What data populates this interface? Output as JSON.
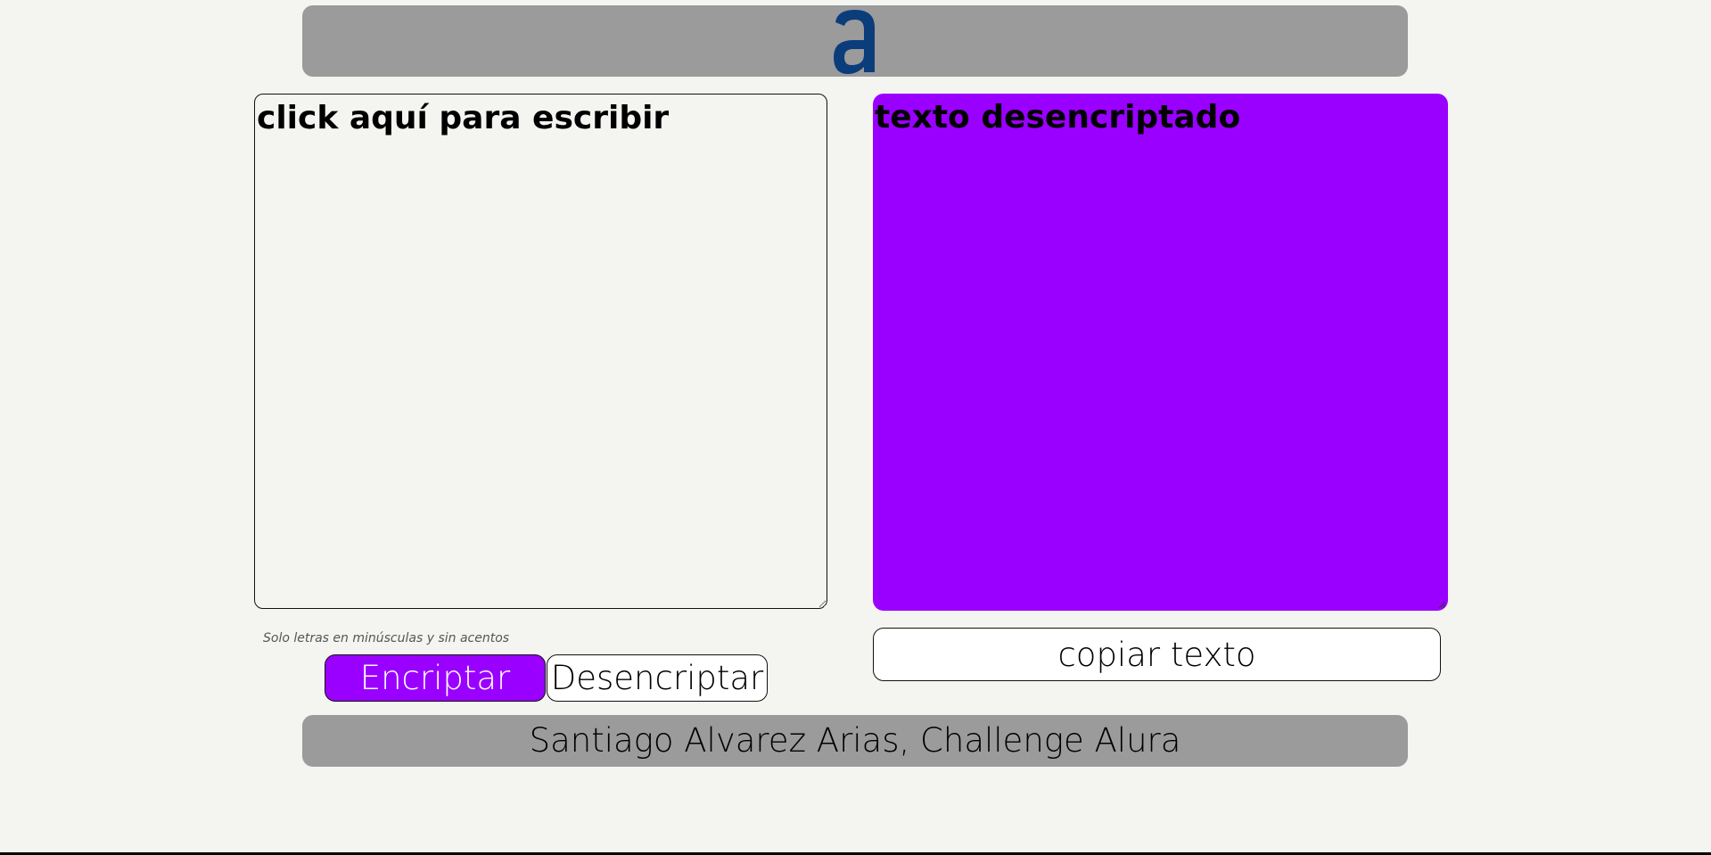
{
  "header": {
    "logo_icon": "alura-a-logo-icon",
    "logo_color": "#0b3d7a"
  },
  "input": {
    "placeholder": "click aquí para escribir",
    "value": ""
  },
  "output": {
    "text": "texto desencriptado",
    "background": "#9a00ff"
  },
  "hint": "Solo letras en minúsculas y sin acentos",
  "buttons": {
    "encrypt": "Encriptar",
    "decrypt": "Desencriptar",
    "copy": "copiar texto"
  },
  "footer": {
    "text": "Santiago Alvarez Arias, Challenge Alura"
  }
}
